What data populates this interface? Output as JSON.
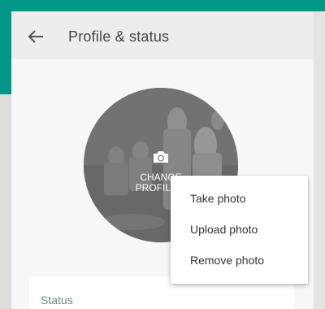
{
  "header": {
    "title": "Profile & status",
    "back_icon": "arrow-left-icon"
  },
  "avatar": {
    "camera_icon": "camera-icon",
    "change_label_line1": "Change",
    "change_label_line2": "Profile P"
  },
  "status": {
    "label": "Status"
  },
  "menu": {
    "items": [
      {
        "label": "Take photo"
      },
      {
        "label": "Upload photo"
      },
      {
        "label": "Remove photo"
      }
    ]
  },
  "colors": {
    "accent": "#009688",
    "header_bg": "#ededed",
    "page_bg": "#f7f7f7"
  }
}
